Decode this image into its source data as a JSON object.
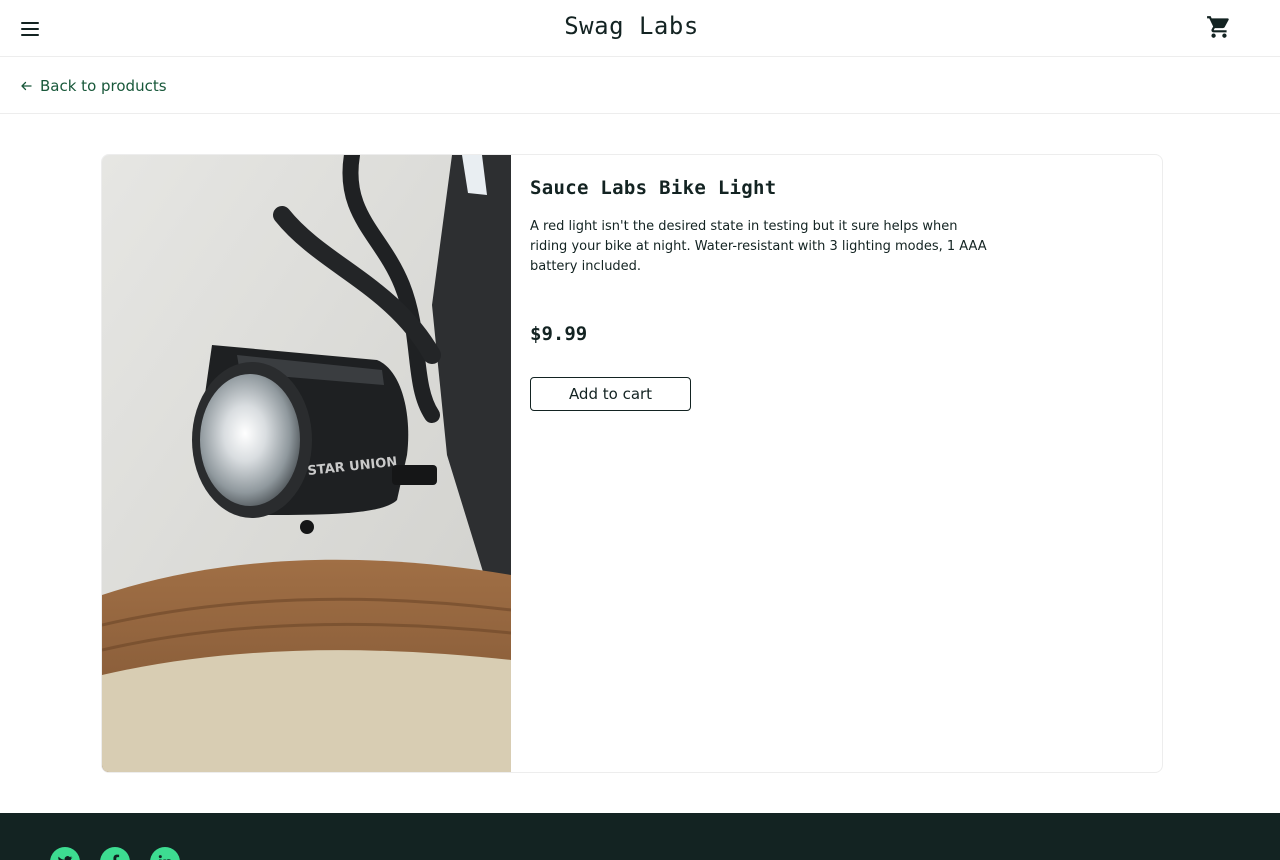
{
  "header": {
    "logo": "Swag Labs",
    "menu_icon": "hamburger-menu-icon",
    "cart_icon": "shopping-cart-icon"
  },
  "navigation": {
    "back_label": "Back to products",
    "back_icon": "arrow-left-icon"
  },
  "product": {
    "name": "Sauce Labs Bike Light",
    "description": "A red light isn't the desired state in testing but it sure helps when riding your bike at night. Water-resistant with 3 lighting modes, 1 AAA battery included.",
    "price": "$9.99",
    "add_button": "Add to cart",
    "image_brand": "STAR UNION"
  },
  "footer": {
    "social_icons": [
      "twitter-icon",
      "facebook-icon",
      "linkedin-icon"
    ]
  },
  "colors": {
    "accent": "#3ddc91",
    "text": "#132322",
    "link": "#18583a",
    "footer_bg": "#132322"
  }
}
